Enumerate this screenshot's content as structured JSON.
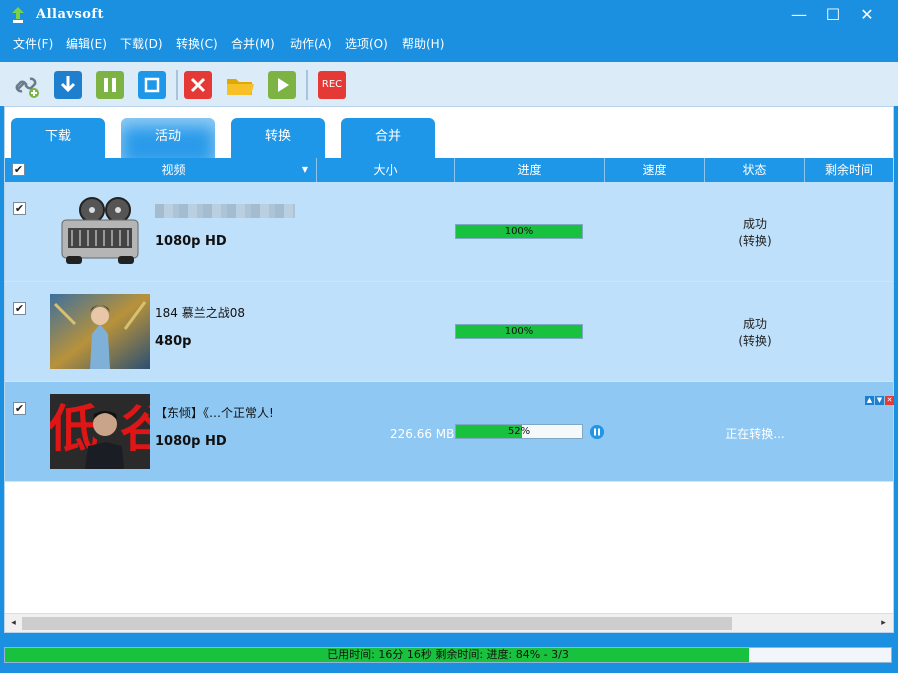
{
  "window": {
    "title": "Allavsoft",
    "minimize": "—",
    "maximize": "☐",
    "close": "✕"
  },
  "menu": [
    "文件(F)",
    "编辑(E)",
    "下载(D)",
    "转换(C)",
    "合并(M)",
    "动作(A)",
    "选项(O)",
    "帮助(H)"
  ],
  "toolbar": {
    "buttons": [
      {
        "name": "add-link-icon",
        "color": "#6b7b8a"
      },
      {
        "name": "download-icon",
        "color": "#1f7fcf"
      },
      {
        "name": "pause-icon",
        "color": "#7cb342"
      },
      {
        "name": "stop-icon",
        "color": "#1f97e8"
      },
      {
        "name": "delete-icon",
        "color": "#e53935"
      },
      {
        "name": "open-folder-icon",
        "color": "#f6c026"
      },
      {
        "name": "play-icon",
        "color": "#7cb342"
      },
      {
        "name": "record-icon",
        "color": "#e53935"
      }
    ],
    "rec_label": "REC"
  },
  "tabs": [
    "下载",
    "活动",
    "转换",
    "合并"
  ],
  "active_tab": 1,
  "columns": {
    "check": "☑",
    "video": "视频",
    "size": "大小",
    "progress": "进度",
    "speed": "速度",
    "status": "状态",
    "remaining": "剩余时间"
  },
  "rows": [
    {
      "checked": "✔",
      "title": "",
      "quality": "1080p HD",
      "size": "",
      "progress": 1.0,
      "progress_label": "100%",
      "status_line1": "成功",
      "status_line2": "(转换)",
      "thumb": "movie-projector"
    },
    {
      "checked": "✔",
      "title": "184 慕兰之战08",
      "quality": "480p",
      "size": "",
      "progress": 1.0,
      "progress_label": "100%",
      "status_line1": "成功",
      "status_line2": "(转换)",
      "thumb": "anime"
    },
    {
      "checked": "✔",
      "title": "【东倾】《…个正常人!",
      "quality": "1080p HD",
      "size": "226.66 MB",
      "progress": 0.52,
      "progress_label": "52%",
      "status_line1": "正在转换...",
      "status_line2": "",
      "thumb": "portrait"
    }
  ],
  "scrollbar": {
    "left": "◂",
    "right": "▸"
  },
  "statusbar": {
    "text": "已用时间: 16分 16秒 剩余时间: 进度: 84% - 3/3",
    "progress": 0.84
  },
  "colors": {
    "accent": "#1b8fe0",
    "progress": "#19c23e"
  }
}
